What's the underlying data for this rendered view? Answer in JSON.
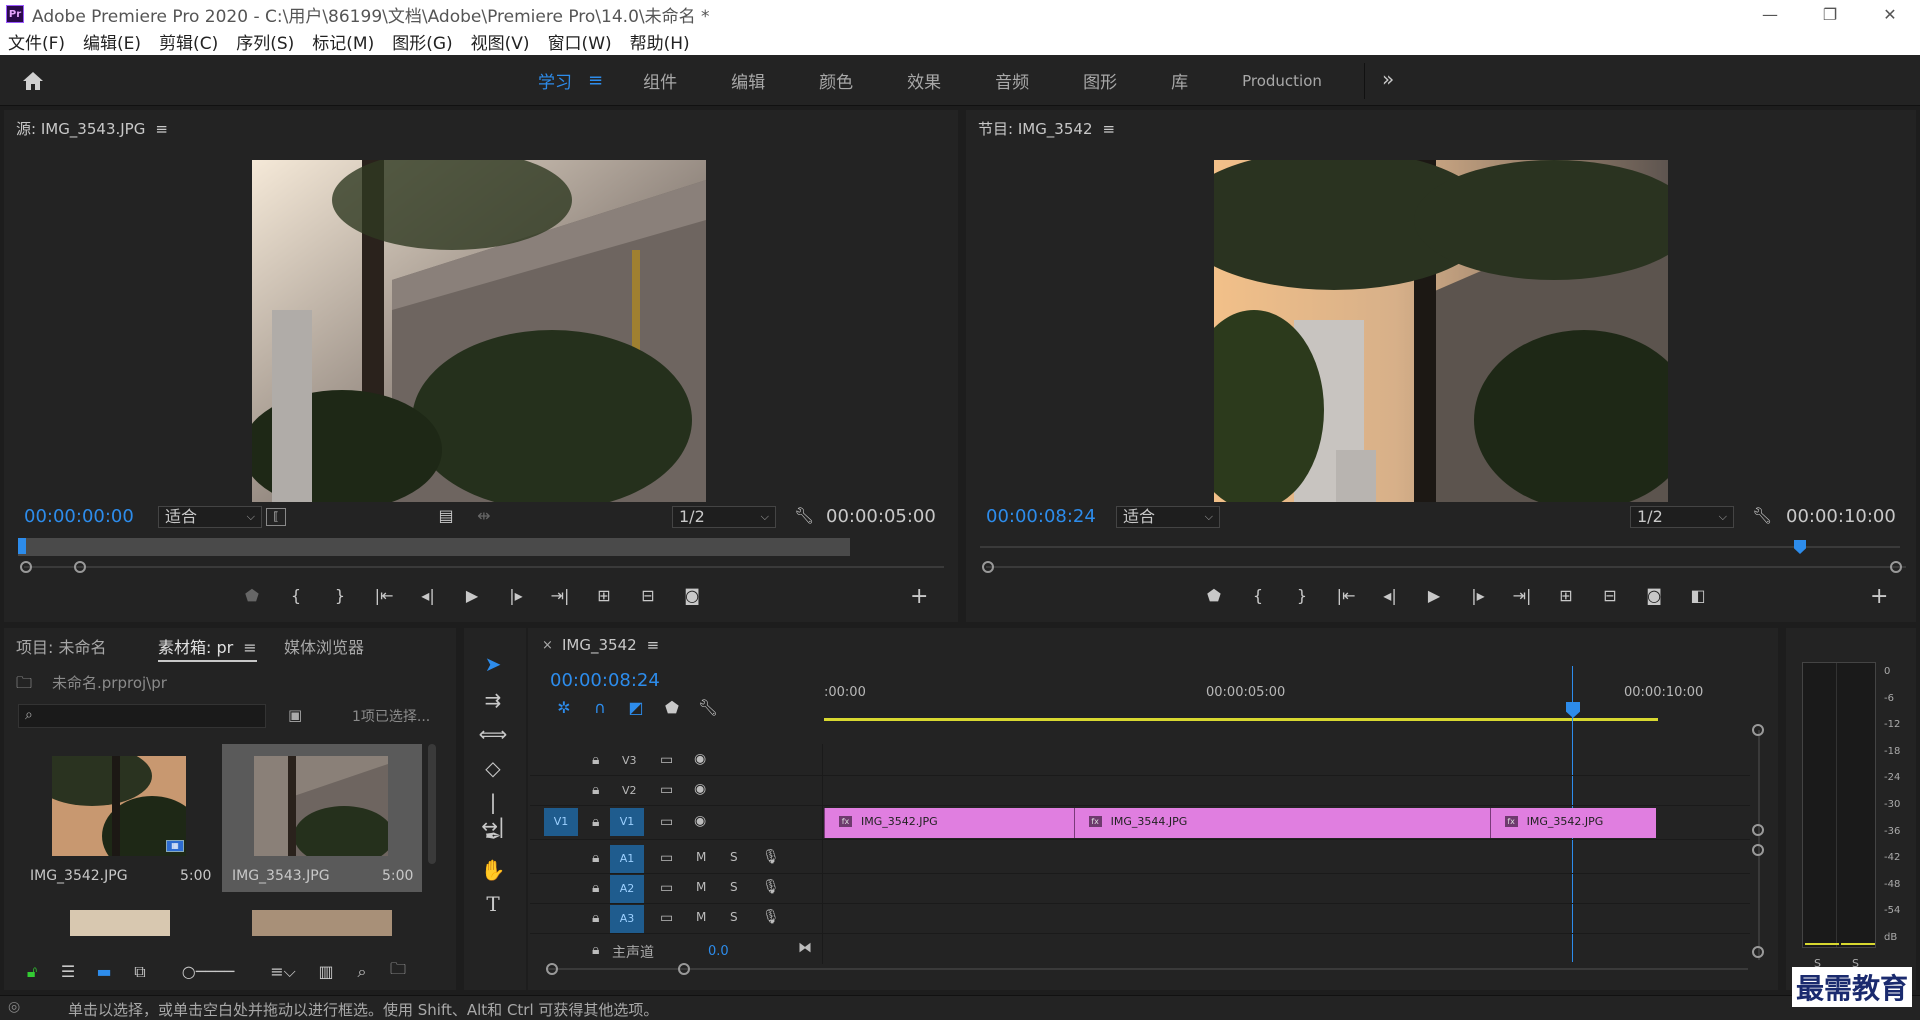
{
  "app": {
    "title": "Adobe Premiere Pro 2020 - C:\\用户\\86199\\文档\\Adobe\\Premiere Pro\\14.0\\未命名 *",
    "logo": "Pr"
  },
  "menu": [
    "文件(F)",
    "编辑(E)",
    "剪辑(C)",
    "序列(S)",
    "标记(M)",
    "图形(G)",
    "视图(V)",
    "窗口(W)",
    "帮助(H)"
  ],
  "workspaces": {
    "active": "学习",
    "items": [
      "组件",
      "编辑",
      "颜色",
      "效果",
      "音频",
      "图形",
      "库"
    ],
    "production": "Production"
  },
  "source_monitor": {
    "title": "源: IMG_3543.JPG",
    "timecode": "00:00:00:00",
    "fit": "适合",
    "resolution": "1/2",
    "duration": "00:00:05:00"
  },
  "program_monitor": {
    "title": "节目: IMG_3542",
    "timecode": "00:00:08:24",
    "fit": "适合",
    "resolution": "1/2",
    "duration": "00:00:10:00"
  },
  "project": {
    "tabs": [
      "项目: 未命名",
      "素材箱: pr",
      "媒体浏览器"
    ],
    "active_tab": "素材箱: pr",
    "path": "未命名.prproj\\pr",
    "search_placeholder": "",
    "selection_info": "1项已选择...",
    "items": [
      {
        "name": "IMG_3542.JPG",
        "duration": "5:00"
      },
      {
        "name": "IMG_3543.JPG",
        "duration": "5:00"
      }
    ]
  },
  "timeline": {
    "sequence": "IMG_3542",
    "timecode": "00:00:08:24",
    "ruler": [
      ":00:00",
      "00:00:05:00",
      "00:00:10:00"
    ],
    "video_tracks": [
      "V3",
      "V2",
      "V1"
    ],
    "audio_tracks": [
      "A1",
      "A2",
      "A3"
    ],
    "source_patch": "V1",
    "master": {
      "label": "主声道",
      "value": "0.0"
    },
    "track_toggles": {
      "mute": "M",
      "solo": "S"
    },
    "clips": [
      {
        "name": "IMG_3542.JPG",
        "start_sec": 0.0,
        "end_sec": 3.0
      },
      {
        "name": "IMG_3544.JPG",
        "start_sec": 3.0,
        "end_sec": 8.0
      },
      {
        "name": "IMG_3542.JPG",
        "start_sec": 8.0,
        "end_sec": 10.0
      }
    ]
  },
  "audio_meter": {
    "scale": [
      "0",
      "-6",
      "-12",
      "-18",
      "-24",
      "-30",
      "-36",
      "-42",
      "-48",
      "-54",
      "dB"
    ],
    "channels": [
      "S",
      "S"
    ]
  },
  "status": {
    "text": "单击以选择，或单击空白处并拖动以进行框选。使用 Shift、Alt和 Ctrl 可获得其他选项。"
  },
  "watermark": "最需教育"
}
